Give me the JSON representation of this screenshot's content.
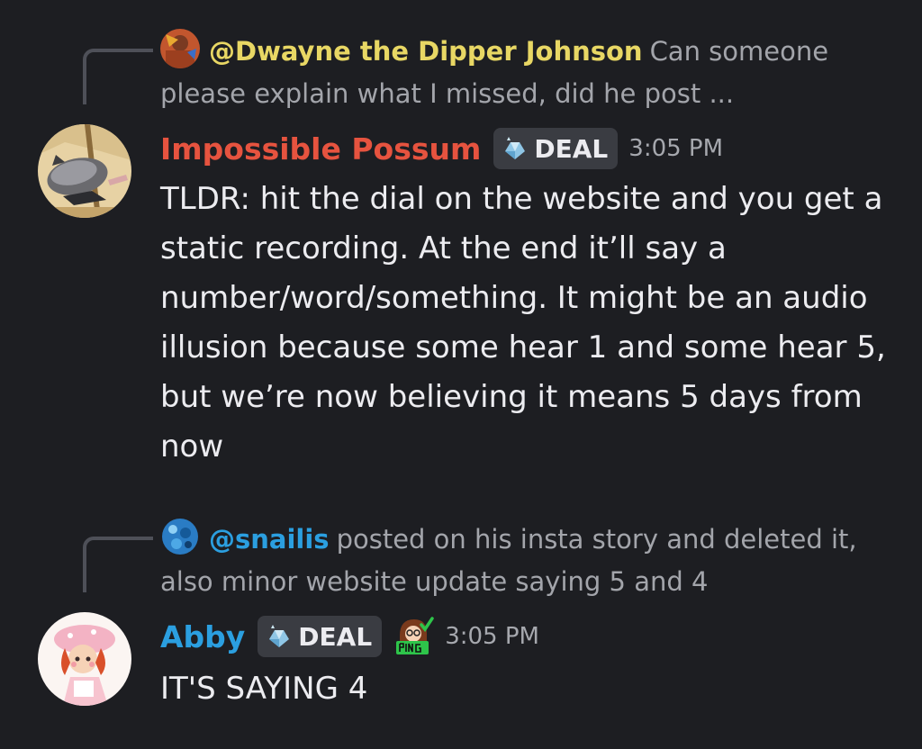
{
  "messages": [
    {
      "reply": {
        "author": "@Dwayne the Dipper Johnson",
        "author_color": "#e8d764",
        "preview": "Can someone please explain what I missed, did he post ..."
      },
      "author": "Impossible Possum",
      "author_color": "#e6533f",
      "tag": "DEAL",
      "time": "3:05 PM",
      "text": "TLDR: hit the dial on the website and you get a static recording. At the end it’ll say a number/word/something. It might be an audio illusion because some hear 1 and some hear 5, but we’re now believing it means 5 days from now",
      "avatar_icon": "possum-avatar-icon"
    },
    {
      "reply": {
        "author": "@snailis",
        "author_color": "#2b9fe0",
        "preview": "posted on his insta story and deleted it, also minor website update saying 5 and 4"
      },
      "author": "Abby",
      "author_color": "#2b9fe0",
      "tag": "DEAL",
      "time": "3:05 PM",
      "text": "IT'S SAYING 4",
      "avatar_icon": "strawberry-shortcake-avatar-icon",
      "emoji_icon": "ping-emoji-icon"
    }
  ]
}
